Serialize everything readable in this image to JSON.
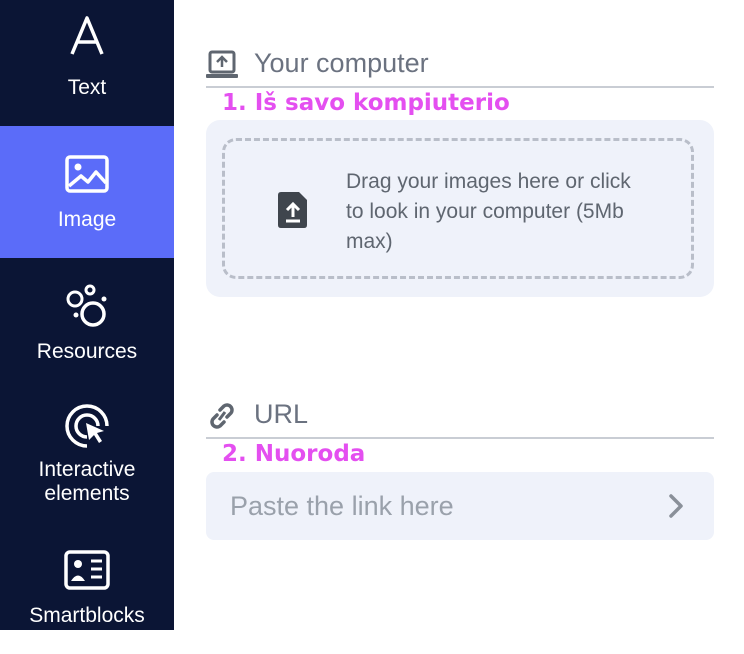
{
  "sidebar": {
    "items": [
      {
        "label": "Text",
        "icon": "letter-a-icon"
      },
      {
        "label": "Image",
        "icon": "image-icon",
        "active": true
      },
      {
        "label": "Resources",
        "icon": "resources-circles-icon"
      },
      {
        "label": "Interactive elements",
        "icon": "interactive-click-icon"
      },
      {
        "label": "Smartblocks",
        "icon": "smartblocks-icon"
      }
    ],
    "colors": {
      "background": "#0b1535",
      "active": "#5b6cf9"
    }
  },
  "computer_section": {
    "title": "Your computer",
    "icon": "laptop-upload-icon",
    "annotation": "1. Iš savo kompiuterio",
    "dropzone_text": "Drag your images here or click to look in your computer (5Mb max)",
    "upload_icon": "file-upload-icon"
  },
  "url_section": {
    "title": "URL",
    "icon": "link-icon",
    "annotation": "2. Nuoroda",
    "input_placeholder": "Paste the link here",
    "submit_icon": "chevron-right-icon"
  },
  "colors": {
    "annotation": "#e44ff0",
    "panel_bg": "#eff2fa",
    "text_gray": "#6b7280"
  }
}
